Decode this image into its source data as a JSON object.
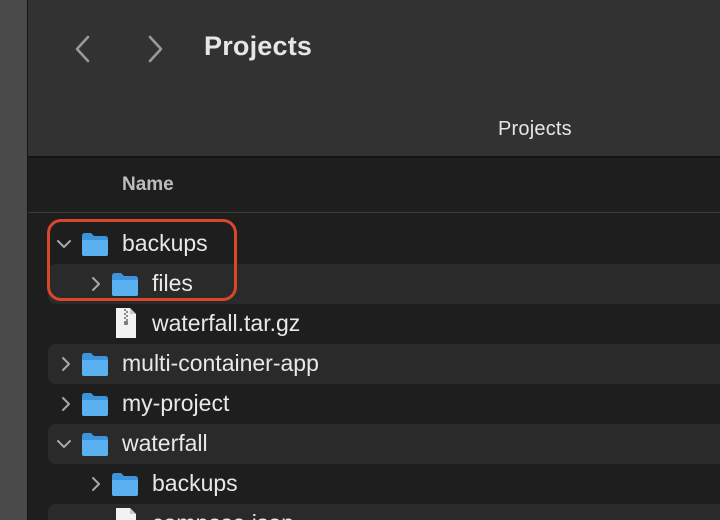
{
  "toolbar": {
    "title": "Projects",
    "path_title": "Projects"
  },
  "list": {
    "column_name": "Name",
    "rows": [
      {
        "label": "backups",
        "kind": "folder",
        "expanded": true,
        "depth": 0
      },
      {
        "label": "files",
        "kind": "folder",
        "expanded": false,
        "depth": 1
      },
      {
        "label": "waterfall.tar.gz",
        "kind": "archive",
        "depth": 1
      },
      {
        "label": "multi-container-app",
        "kind": "folder",
        "expanded": false,
        "depth": 0
      },
      {
        "label": "my-project",
        "kind": "folder",
        "expanded": false,
        "depth": 0
      },
      {
        "label": "waterfall",
        "kind": "folder",
        "expanded": true,
        "depth": 0
      },
      {
        "label": "backups",
        "kind": "folder",
        "expanded": false,
        "depth": 1
      },
      {
        "label": "compose.json",
        "kind": "file",
        "depth": 1
      }
    ]
  },
  "annotation": {
    "color": "#d8472a"
  },
  "colors": {
    "folder": "#4ba3e8",
    "text": "#e8e8e8"
  }
}
